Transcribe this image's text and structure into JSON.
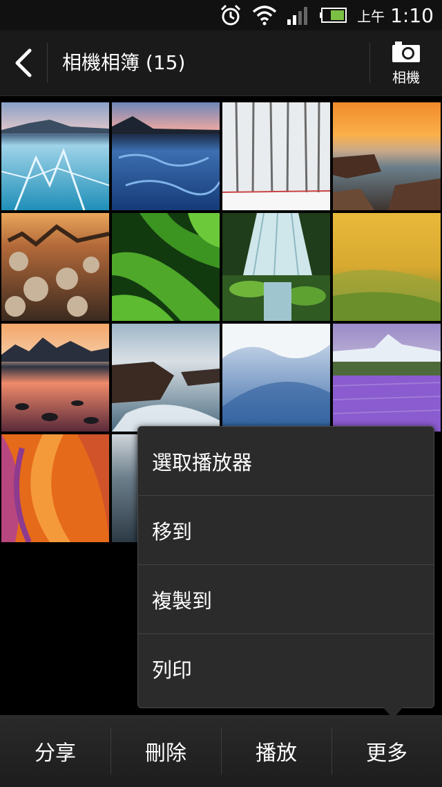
{
  "status": {
    "ampm": "上午",
    "time": "1:10",
    "icons": [
      "alarm-icon",
      "wifi-icon",
      "signal-icon",
      "battery-icon"
    ]
  },
  "header": {
    "title": "相機相簿 (15)",
    "camera_label": "相機"
  },
  "menu": {
    "items": [
      "選取播放器",
      "移到",
      "複製到",
      "列印"
    ]
  },
  "bottom": {
    "share": "分享",
    "delete": "刪除",
    "play": "播放",
    "more": "更多"
  },
  "thumbnails": [
    {
      "name": "frozen-lake"
    },
    {
      "name": "blue-lake-sunset"
    },
    {
      "name": "snowy-forest"
    },
    {
      "name": "sunset-coast"
    },
    {
      "name": "desert-cactus"
    },
    {
      "name": "green-leaves"
    },
    {
      "name": "waterfall"
    },
    {
      "name": "golden-hills"
    },
    {
      "name": "mountain-reflection"
    },
    {
      "name": "rocky-shore"
    },
    {
      "name": "snow-drift"
    },
    {
      "name": "lavender-field"
    },
    {
      "name": "canyon-swirl"
    },
    {
      "name": "misty-water"
    }
  ]
}
